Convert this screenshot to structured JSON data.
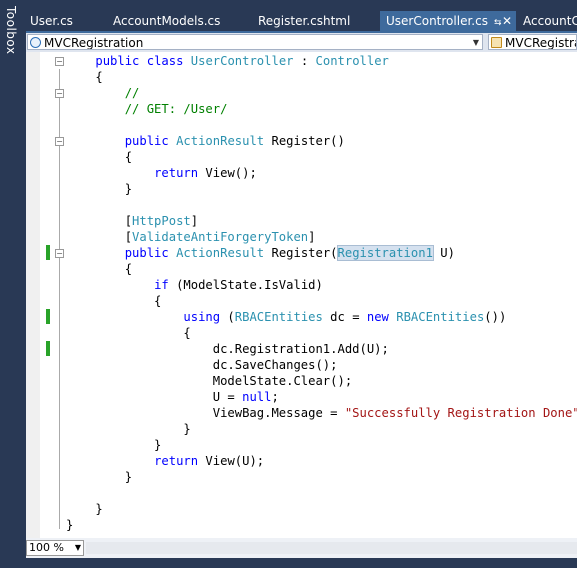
{
  "toolbox": {
    "label": "Toolbox"
  },
  "tabs": [
    {
      "label": "User.cs"
    },
    {
      "label": "AccountModels.cs"
    },
    {
      "label": "Register.cshtml"
    },
    {
      "label": "UserController.cs",
      "pin": "⇆",
      "close": "✕"
    },
    {
      "label": "AccountC"
    }
  ],
  "navbar": {
    "project": "MVCRegistration",
    "class": "MVCRegistrat"
  },
  "code": [
    "    public class UserController : Controller",
    "    {",
    "        //",
    "        // GET: /User/",
    "",
    "        public ActionResult Register()",
    "        {",
    "            return View();",
    "        }",
    "",
    "        [HttpPost]",
    "        [ValidateAntiForgeryToken]",
    "        public ActionResult Register(Registration1 U)",
    "        {",
    "            if (ModelState.IsValid)",
    "            {",
    "                using (RBACEntities dc = new RBACEntities())",
    "                {",
    "                    dc.Registration1.Add(U);",
    "                    dc.SaveChanges();",
    "                    ModelState.Clear();",
    "                    U = null;",
    "                    ViewBag.Message = \"Successfully Registration Done\";",
    "                }",
    "            }",
    "            return View(U);",
    "        }",
    "",
    "    }",
    "}"
  ],
  "zoom": {
    "value": "100 %"
  },
  "colors": {
    "keyword": "#0000ff",
    "type": "#2b91af",
    "comment": "#008000",
    "string": "#a31515",
    "changebar": "#29a329"
  }
}
